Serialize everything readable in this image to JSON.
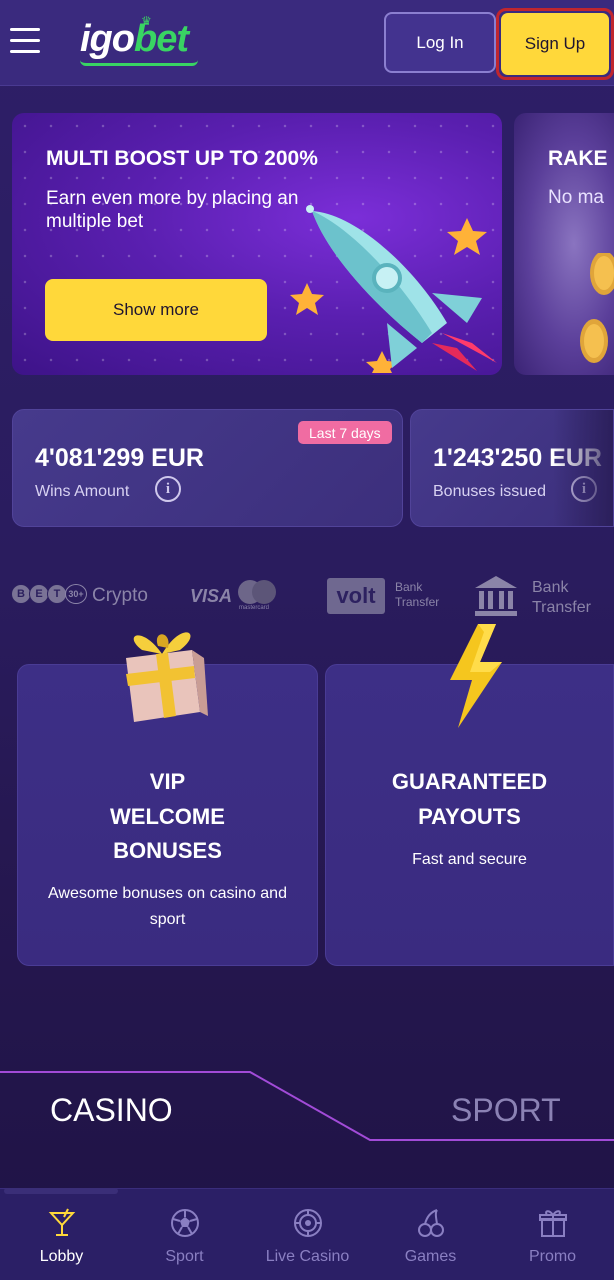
{
  "header": {
    "logo_text_white": "igo",
    "logo_text_green": "bet",
    "login_label": "Log In",
    "signup_label": "Sign Up"
  },
  "banner": {
    "title": "MULTI BOOST UP TO 200%",
    "subtitle": "Earn even more by placing an multiple bet",
    "button_label": "Show more"
  },
  "banner_next": {
    "title": "RAKE",
    "subtitle": "No ma"
  },
  "stats": [
    {
      "value": "4'081'299 EUR",
      "label": "Wins Amount",
      "badge": "Last 7 days"
    },
    {
      "value": "1'243'250 EUR",
      "label": "Bonuses issued"
    }
  ],
  "payments": {
    "coins": [
      "B",
      "E",
      "T",
      "30+"
    ],
    "crypto_label": "Crypto",
    "visa_label": "VISA",
    "mastercard_label": "mastercard",
    "volt_label": "volt",
    "volt_sub": "Bank Transfer",
    "bank_label": "Bank Transfer"
  },
  "features": [
    {
      "title": "VIP WELCOME BONUSES",
      "subtitle": "Awesome bonuses on casino and sport",
      "icon": "gift-icon"
    },
    {
      "title": "GUARANTEED PAYOUTS",
      "subtitle": "Fast and secure",
      "icon": "lightning-icon"
    }
  ],
  "tabs": {
    "casino": "CASINO",
    "sport": "SPORT"
  },
  "nav": [
    {
      "label": "Lobby",
      "icon": "cocktail-icon",
      "active": true
    },
    {
      "label": "Sport",
      "icon": "soccer-ball-icon",
      "active": false
    },
    {
      "label": "Live Casino",
      "icon": "roulette-icon",
      "active": false
    },
    {
      "label": "Games",
      "icon": "cherries-icon",
      "active": false
    },
    {
      "label": "Promo",
      "icon": "gift-icon",
      "active": false
    }
  ],
  "colors": {
    "accent_yellow": "#ffd83a",
    "brand_green": "#39d463",
    "badge_pink": "#f06ca2",
    "header_bg": "#3a2a7e",
    "signup_outline_red": "#c0262e"
  }
}
